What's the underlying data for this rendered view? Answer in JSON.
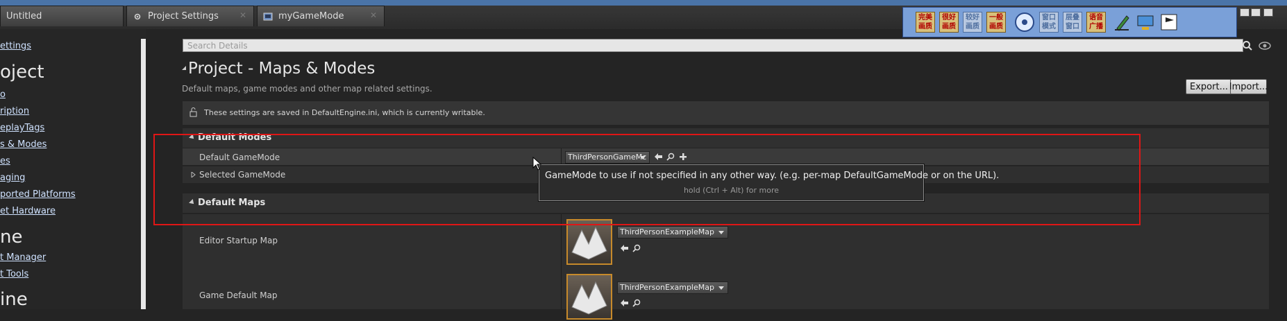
{
  "tabs": [
    {
      "label": "Untitled"
    },
    {
      "label": "Project Settings",
      "close": "✕"
    },
    {
      "label": "myGameMode",
      "close": "✕"
    }
  ],
  "sidebar": {
    "items": [
      {
        "type": "link",
        "text": "ettings"
      },
      {
        "type": "heading",
        "text": "oject"
      },
      {
        "type": "link",
        "text": "o"
      },
      {
        "type": "link",
        "text": "ription"
      },
      {
        "type": "link",
        "text": "eplayTags"
      },
      {
        "type": "link",
        "text": "s & Modes"
      },
      {
        "type": "link",
        "text": "es"
      },
      {
        "type": "link",
        "text": "aging"
      },
      {
        "type": "link",
        "text": "ported Platforms"
      },
      {
        "type": "link",
        "text": "et Hardware"
      },
      {
        "type": "heading",
        "text": "ne"
      },
      {
        "type": "link",
        "text": "t Manager"
      },
      {
        "type": "link",
        "text": "t Tools"
      },
      {
        "type": "heading",
        "text": "ine"
      }
    ]
  },
  "search": {
    "placeholder": "Search Details"
  },
  "page": {
    "title": "Project - Maps & Modes",
    "subtitle": "Default maps, game modes and other map related settings.",
    "export_label": "Export...",
    "import_label": "Import...",
    "notice": "These settings are saved in DefaultEngine.ini, which is currently writable."
  },
  "sections": {
    "modes": {
      "title": "Default Modes",
      "default_gamemode_label": "Default GameMode",
      "default_gamemode_value": "ThirdPersonGameMc",
      "selected_gamemode_label": "Selected GameMode"
    },
    "maps": {
      "title": "Default Maps",
      "editor_startup_label": "Editor Startup Map",
      "editor_startup_value": "ThirdPersonExampleMap",
      "game_default_label": "Game Default Map",
      "game_default_value": "ThirdPersonExampleMap"
    }
  },
  "tooltip": {
    "text": "GameMode to use if not specified in any other way. (e.g. per-map DefaultGameMode or on the URL).",
    "more": "hold (Ctrl + Alt) for more"
  },
  "ime_toolbar": {
    "buttons": [
      {
        "label": "完美画质"
      },
      {
        "label": "很好画质"
      },
      {
        "label": "较好画质"
      },
      {
        "label": "一般画质"
      },
      {
        "label": "窗口模式"
      },
      {
        "label": "层叠窗口"
      },
      {
        "label": "语音广播"
      }
    ]
  },
  "colors": {
    "highlight": "#e01616",
    "accent": "#c78a2b",
    "link": "#cfe2ff"
  }
}
